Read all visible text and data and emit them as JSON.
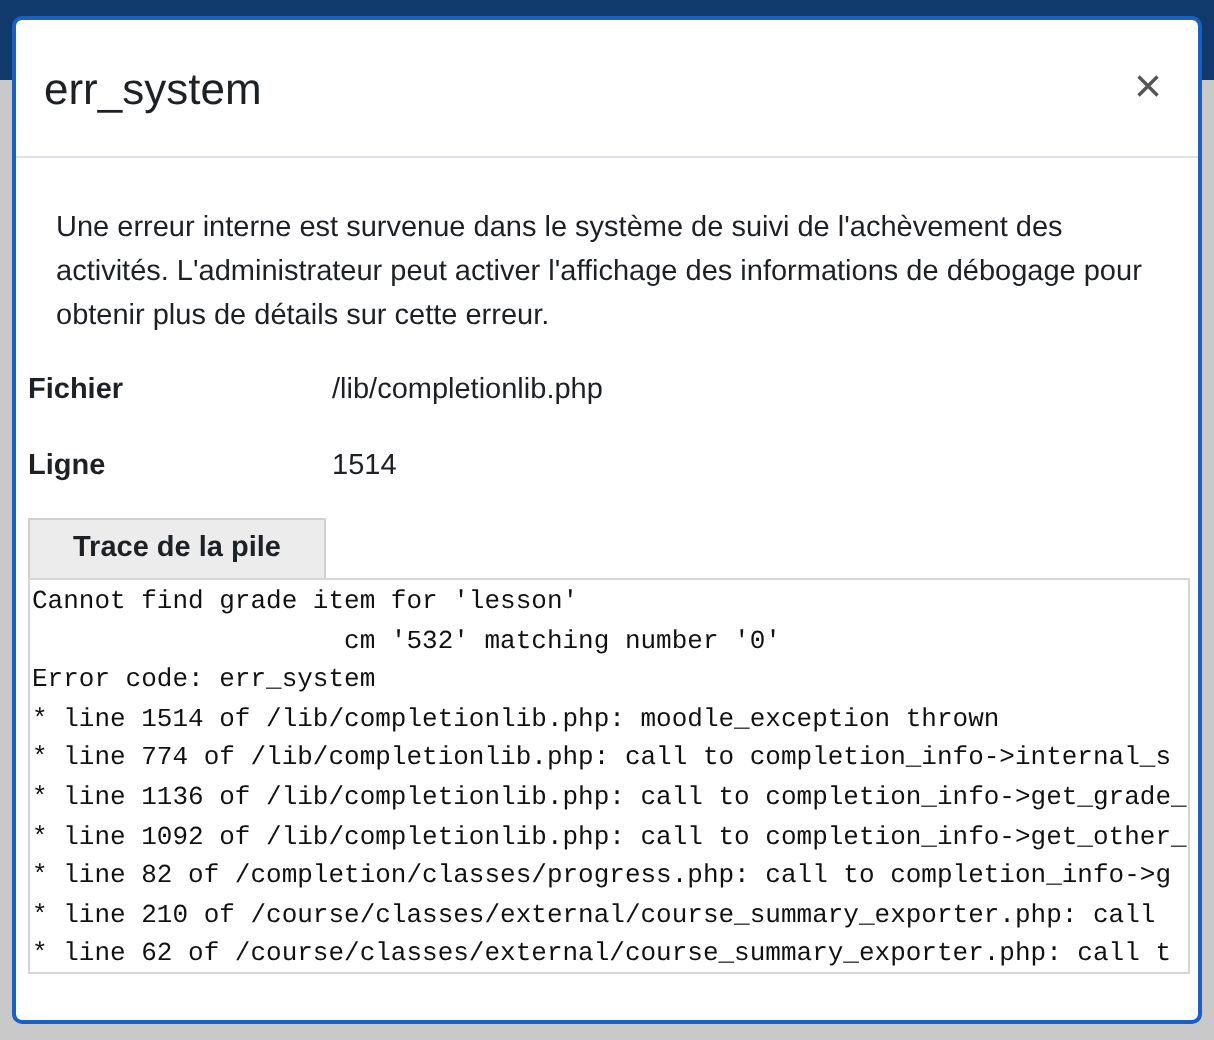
{
  "dialog": {
    "title": "err_system",
    "close": "×"
  },
  "message": "Une erreur interne est survenue dans le système de suivi de l'achèvement des activités. L'administrateur peut activer l'affichage des informations de débogage pour obtenir plus de détails sur cette erreur.",
  "details": [
    {
      "label": "Fichier",
      "value": "/lib/completionlib.php"
    },
    {
      "label": "Ligne",
      "value": "1514"
    }
  ],
  "trace": {
    "tab": "Trace de la pile",
    "lines": [
      "Cannot find grade item for 'lesson'",
      "                    cm '532' matching number '0'",
      "Error code: err_system",
      "* line 1514 of /lib/completionlib.php: moodle_exception thrown",
      "* line 774 of /lib/completionlib.php: call to completion_info->internal_s",
      "* line 1136 of /lib/completionlib.php: call to completion_info->get_grade_",
      "* line 1092 of /lib/completionlib.php: call to completion_info->get_other_",
      "* line 82 of /completion/classes/progress.php: call to completion_info->g",
      "* line 210 of /course/classes/external/course_summary_exporter.php: call",
      "* line 62 of /course/classes/external/course_summary_exporter.php: call t"
    ]
  }
}
